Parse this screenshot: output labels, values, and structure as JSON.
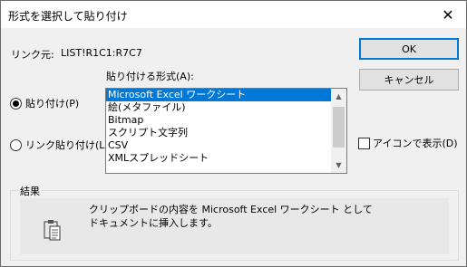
{
  "window": {
    "title": "形式を選択して貼り付け",
    "close_glyph": "✕"
  },
  "source": {
    "label": "リンク元:",
    "value": "LIST!R1C1:R7C7"
  },
  "paste_options": {
    "paste_label": "貼り付け(P)",
    "paste_link_label": "リンク貼り付け(L)",
    "selected": "paste"
  },
  "format_list": {
    "label": "貼り付ける形式(A):",
    "items": [
      "Microsoft Excel ワークシート",
      "絵(メタファイル)",
      "Bitmap",
      "スクリプト文字列",
      "CSV",
      "XMLスプレッドシート"
    ],
    "selected_index": 0
  },
  "buttons": {
    "ok": "OK",
    "cancel": "キャンセル"
  },
  "display_as_icon": {
    "label": "アイコンで表示(D)",
    "checked": false
  },
  "result": {
    "label": "結果",
    "line1": "クリップボードの内容を Microsoft Excel ワークシート として",
    "line2": "ドキュメントに挿入します。"
  },
  "colors": {
    "selection": "#0078d7",
    "background": "#f0f0f0"
  }
}
